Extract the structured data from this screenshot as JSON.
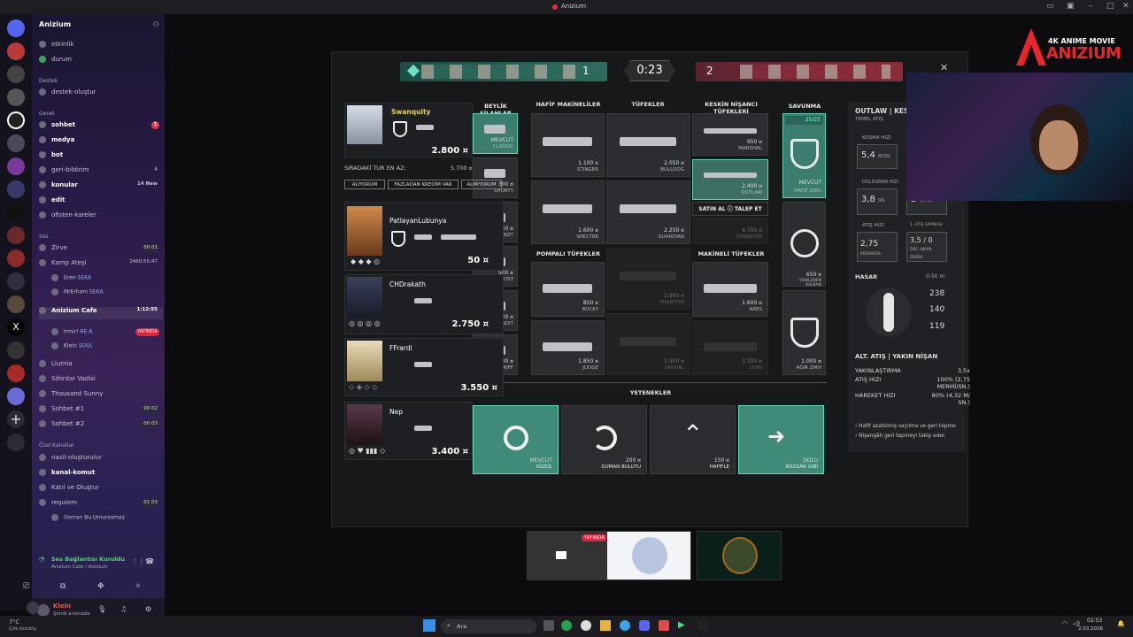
{
  "window": {
    "title": "Anizium"
  },
  "server": {
    "name": "Anizium"
  },
  "channels": [
    {
      "name": "etkinlik",
      "b": false
    },
    {
      "name": "durum",
      "b": false
    }
  ],
  "cat_destek": "Destek",
  "destek_items": [
    {
      "name": "destek-oluştur"
    }
  ],
  "cat_genel": "Genel",
  "genel_items": [
    {
      "name": "sohbet",
      "badge": "1"
    },
    {
      "name": "medya",
      "badge": ""
    },
    {
      "name": "bot",
      "badge": ""
    },
    {
      "name": "geri-bildirim",
      "badge": "4"
    },
    {
      "name": "konular",
      "badge": "14 New"
    },
    {
      "name": "edit",
      "badge": ""
    },
    {
      "name": "ofisten-kareler",
      "badge": ""
    }
  ],
  "cat_ses": "Ses",
  "voice_channels": [
    {
      "name": "Zirve",
      "badge": "00 01"
    },
    {
      "name": "Kamp Ateşi",
      "badge": "2460:55:47"
    },
    {
      "name": "Eren",
      "tag": "SEKA"
    },
    {
      "name": "MrErham",
      "tag": "SEKA"
    },
    {
      "name": "Anizium Cafe",
      "badge": "1:12:55"
    },
    {
      "name": "Irmir!",
      "tag": "RE-A",
      "live": "YAYINDA"
    },
    {
      "name": "Klein",
      "tag": "SOUL"
    },
    {
      "name": "Liurnia",
      "badge": ""
    },
    {
      "name": "Sihirdar Vadisi",
      "badge": ""
    },
    {
      "name": "Thousand Sunny",
      "badge": ""
    },
    {
      "name": "Sohbet #1",
      "badge": "00 02"
    },
    {
      "name": "Sohbet #2",
      "badge": "00 03"
    }
  ],
  "cat_ozel": "Özel Kanallar",
  "ozel_items": [
    {
      "name": "nasil-oluşturulur"
    },
    {
      "name": "kanal-komut"
    },
    {
      "name": "Katıl ve Oluştur"
    },
    {
      "name": "requiem",
      "badge": "01 03"
    },
    {
      "name": "Osman Bu Umursamaz"
    }
  ],
  "voice_status": {
    "title": "Ses Bağlantısı Kuruldu",
    "sub": "Anizium Cafe / Anizium"
  },
  "user": {
    "name": "Klein",
    "status": "Şimdi aramada"
  },
  "scoreboard": {
    "left": "1",
    "timer": "0:23",
    "right": "2"
  },
  "shop": {
    "col_headers": [
      "BEYLİK SİLAHLAR",
      "HAFİF MAKİNELİLER",
      "TÜFEKLER",
      "KESKİN NİŞANCI TÜFEKLERİ",
      "SAVUNMA"
    ],
    "sidearms": [
      {
        "price": "MEVCUT",
        "name": "CLASSIC"
      },
      {
        "price": "300 ¤",
        "name": "SHORTY"
      },
      {
        "price": "450 ¤",
        "name": "FRENZY"
      },
      {
        "price": "500 ¤",
        "name": "GHOST"
      },
      {
        "price": "600 ¤",
        "name": "BANDIT"
      },
      {
        "price": "800 ¤",
        "name": "SHERIFF"
      }
    ],
    "smgs": [
      {
        "price": "1.100 ¤",
        "name": "STINGER"
      },
      {
        "price": "1.600 ¤",
        "name": "SPECTRE"
      }
    ],
    "shotgun_header": "POMPALI TÜFEKLER",
    "shotguns": [
      {
        "price": "850 ¤",
        "name": "BUCKY"
      },
      {
        "price": "1.850 ¤",
        "name": "JUDGE"
      }
    ],
    "rifles": [
      {
        "price": "2.050 ¤",
        "name": "BULLDOG"
      },
      {
        "price": "2.250 ¤",
        "name": "GUARDIAN"
      },
      {
        "price": "2.900 ¤",
        "name": "PHANTOM"
      },
      {
        "price": "2.900 ¤",
        "name": "VANDAL"
      }
    ],
    "snipers": [
      {
        "price": "950 ¤",
        "name": "MARSHAL"
      },
      {
        "price": "2.400 ¤",
        "name": "OUTLAW"
      },
      {
        "price": "4.700 ¤",
        "name": "OPERATOR"
      }
    ],
    "buy_bar": {
      "buy": "SATIN AL",
      "request": "TALEP ET"
    },
    "mg_header": "MAKİNELİ TÜFEKLER",
    "mgs": [
      {
        "price": "1.600 ¤",
        "name": "ARES"
      },
      {
        "price": "3.200 ¤",
        "name": "ODIN"
      }
    ],
    "armor": [
      {
        "tag": "25/25",
        "price": "MEVCUT",
        "name": "HAFİF ZIRH"
      },
      {
        "price": "650 ¤",
        "name": "YENİLENEN KALKAN"
      },
      {
        "price": "1.000 ¤",
        "name": "AĞIR ZIRH"
      }
    ],
    "abilities_header": "YETENEKLER",
    "abilities": [
      {
        "price": "MEVCUT",
        "name": "SÜZÜL",
        "sel": true
      },
      {
        "price": "200 ¤",
        "name": "DUMAN BULUTU",
        "sel": false
      },
      {
        "price": "150 ¤",
        "name": "HAFİFLE",
        "sel": false
      },
      {
        "price": "DOLU",
        "name": "RÜZGÂR GİBİ",
        "sel": true
      }
    ]
  },
  "players": [
    {
      "name": "Swanquity",
      "money": "2.800 ¤"
    },
    {
      "name": "PatlayanLubunya",
      "money": "50 ¤"
    },
    {
      "name": "CHDrakath",
      "money": "2.750 ¤"
    },
    {
      "name": "FFrardi",
      "money": "3.550 ¤"
    },
    {
      "name": "Nep",
      "money": "3.400 ¤"
    }
  ],
  "next_round": {
    "label": "SIRADAKİ TUR EN AZ:",
    "value": "5.700 ¤",
    "btns": [
      "ALIYORUM",
      "FAZLADAN KREDİM VAR",
      "ALMIYORUM"
    ]
  },
  "stats": {
    "title": "OUTLAW | KESKİN",
    "sub": "TEMEL ATIŞ",
    "rows": [
      {
        "label": "KOŞMA HIZI",
        "value": "5,4",
        "unit": "M/SN."
      },
      {
        "label": "DOLDURMA HIZI",
        "value": "3,8",
        "unit": "SN."
      },
      {
        "label": "ATIŞ HIZI",
        "value": "2,75",
        "unit": "MERMİ/SN."
      }
    ],
    "right": [
      {
        "value": "2",
        "unit": "SAYISI"
      },
      {
        "label": "1. ATIŞ SAPMASI",
        "value": "3,5 / 0",
        "unit": "DRC (NRML DRBN)"
      }
    ],
    "damage": {
      "label": "HASAR",
      "range": "0-50 m",
      "vals": [
        "238",
        "140",
        "119"
      ]
    },
    "alt": {
      "title": "ALT. ATIŞ | YAKIN NİŞAN",
      "rows": [
        {
          "k": "YAKINLAŞTIRMA",
          "v": "3,5x"
        },
        {
          "k": "ATIŞ HIZI",
          "v": "100% (2,75 MERMİ/SN.)"
        },
        {
          "k": "HAREKET HIZI",
          "v": "80% (4,32 M/ SN.)"
        }
      ],
      "notes": [
        "Hafif azaltılmış saçılma ve geri tepme",
        "Nişangâh geri tepmeyi takip eder."
      ]
    }
  },
  "brand": {
    "line1": "4K ANIME MOVIE",
    "line2": "ANIZIUM"
  },
  "live": "YAYINDA",
  "taskbar": {
    "weather": "7°C",
    "weather_sub": "Çok bulutlu",
    "search": "Ara",
    "time": "02:53",
    "date": "2.03.2026"
  }
}
